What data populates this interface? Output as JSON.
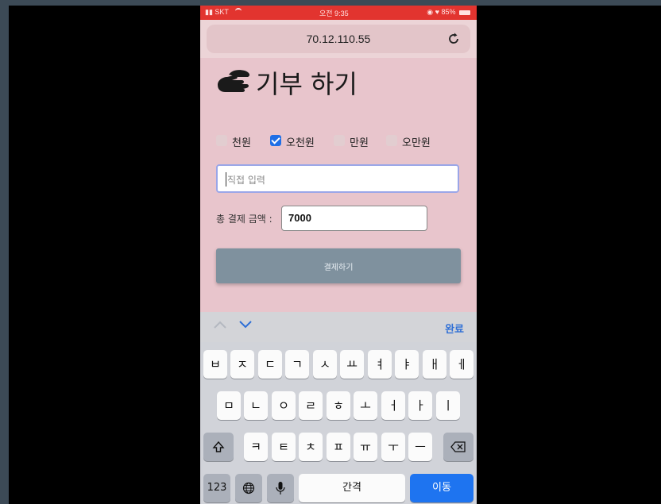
{
  "status_bar": {
    "carrier": "SKT",
    "time": "오전 9:35",
    "battery": "85%"
  },
  "browser": {
    "url": "70.12.110.55"
  },
  "page": {
    "title": "기부 하기",
    "options": [
      {
        "label": "천원",
        "checked": false
      },
      {
        "label": "오천원",
        "checked": true
      },
      {
        "label": "만원",
        "checked": false
      },
      {
        "label": "오만원",
        "checked": false
      }
    ],
    "direct_input_placeholder": "직접 입력",
    "total_label": "총 결제 금액 :",
    "total_value": "7000",
    "pay_button": "결제하기"
  },
  "keyboard_accessory": {
    "done": "완료"
  },
  "keyboard": {
    "row1": [
      "ㅂ",
      "ㅈ",
      "ㄷ",
      "ㄱ",
      "ㅅ",
      "ㅛ",
      "ㅕ",
      "ㅑ",
      "ㅐ",
      "ㅔ"
    ],
    "row2": [
      "ㅁ",
      "ㄴ",
      "ㅇ",
      "ㄹ",
      "ㅎ",
      "ㅗ",
      "ㅓ",
      "ㅏ",
      "ㅣ"
    ],
    "row3": [
      "ㅋ",
      "ㅌ",
      "ㅊ",
      "ㅍ",
      "ㅠ",
      "ㅜ",
      "ㅡ"
    ],
    "numbers_key": "123",
    "space_key": "간격",
    "go_key": "이동"
  }
}
